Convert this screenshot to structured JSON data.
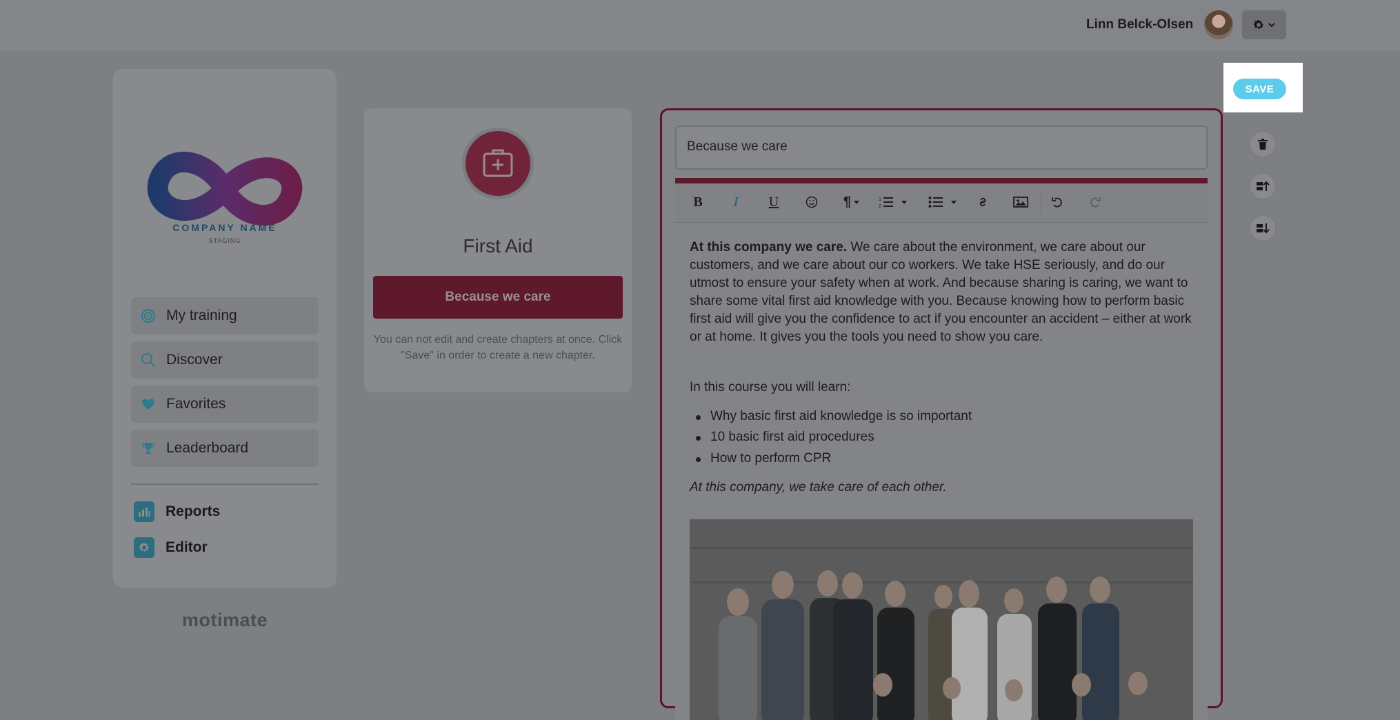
{
  "header": {
    "user_name": "Linn Belck-Olsen"
  },
  "sidebar": {
    "company_name": "COMPANY NAME",
    "company_sub": "STAGING",
    "nav": [
      {
        "label": "My training",
        "icon": "target-icon"
      },
      {
        "label": "Discover",
        "icon": "search-icon"
      },
      {
        "label": "Favorites",
        "icon": "heart-icon"
      },
      {
        "label": "Leaderboard",
        "icon": "trophy-icon"
      }
    ],
    "tools": [
      {
        "label": "Reports",
        "icon": "bar-chart-icon"
      },
      {
        "label": "Editor",
        "icon": "gear-icon"
      }
    ],
    "footer_brand": "motimate"
  },
  "chapter": {
    "title": "First Aid",
    "button_label": "Because we care",
    "note": "You can not edit and create chapters at once. Click \"Save\" in order to create a new chapter."
  },
  "save_label": "SAVE",
  "editor": {
    "title_value": "Because we care",
    "toolbar": [
      "bold",
      "italic",
      "underline",
      "emoji",
      "paragraph",
      "ordered-list",
      "unordered-list",
      "link",
      "image",
      "undo",
      "redo"
    ],
    "intro_bold": "At this company we care.",
    "intro_rest": "We care about the environment, we care about our customers, and we care about our co workers. We take HSE seriously, and do our utmost to ensure your safety when at work. And because sharing is caring, we want to share some vital first aid knowledge with you. Because knowing how to perform basic first aid will give you the confidence to act if you encounter an accident – either at work or at home. It gives you the tools you need to show you care.",
    "learn_heading": "In this course you will learn:",
    "bullets": [
      "Why basic first aid knowledge is so important",
      "10 basic first aid procedures",
      "How to perform CPR"
    ],
    "closing": "At this company, we take care of each other."
  },
  "colors": {
    "accent_red": "#c8173f",
    "save_blue": "#5bcdea",
    "icon_teal": "#3fb3d4"
  }
}
